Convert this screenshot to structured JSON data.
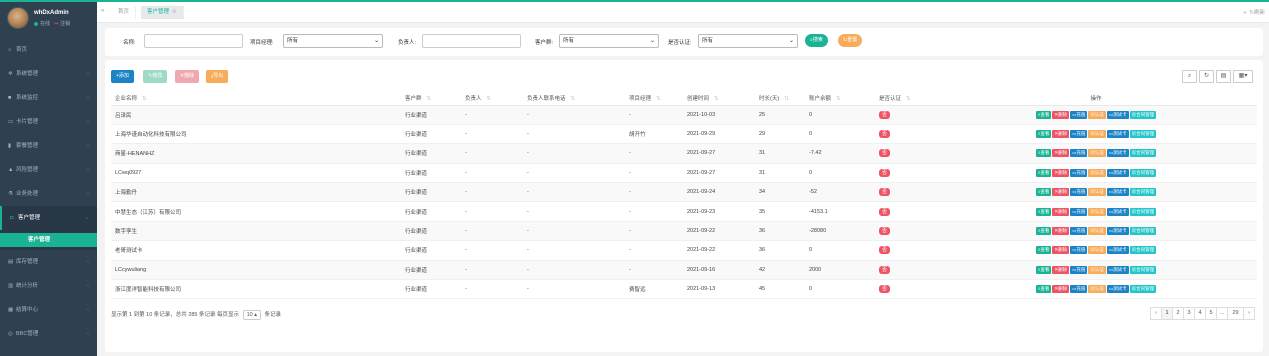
{
  "sidebar": {
    "username": "whDxAdmin",
    "status_online": "在线",
    "status_logout": "注销",
    "items": [
      {
        "label": "首页",
        "icon": "home-icon"
      },
      {
        "label": "系统管理",
        "icon": "gear-icon"
      },
      {
        "label": "系统监控",
        "icon": "video-icon"
      },
      {
        "label": "卡片管理",
        "icon": "card-icon"
      },
      {
        "label": "套餐管理",
        "icon": "chart-bar-icon"
      },
      {
        "label": "风险管理",
        "icon": "warning-icon"
      },
      {
        "label": "业务处理",
        "icon": "flask-icon"
      },
      {
        "label": "客户管理",
        "icon": "user-icon"
      },
      {
        "label": "库存管理",
        "icon": "database-icon"
      },
      {
        "label": "统计分析",
        "icon": "bar-chart-icon"
      },
      {
        "label": "结算中心",
        "icon": "settle-icon"
      },
      {
        "label": "BBC管理",
        "icon": "circle-icon"
      }
    ],
    "sub_active": "客户管理"
  },
  "tabs": {
    "home": "首页",
    "current": "客户管理",
    "refresh": "刷新"
  },
  "filter": {
    "name_label": "名称:",
    "name_value": "",
    "pm_label": "项目经理:",
    "pm_value": "所有",
    "owner_label": "负责人:",
    "owner_value": "",
    "group_label": "客户群:",
    "group_value": "所有",
    "cert_label": "是否认证:",
    "cert_value": "所有",
    "search_btn": "搜索",
    "reset_btn": "重置"
  },
  "toolbar": {
    "add": "添加",
    "edit": "修改",
    "delete": "删除",
    "export": "导出"
  },
  "table": {
    "headers": [
      "企业名称",
      "客户群",
      "负责人",
      "负责人联系电话",
      "项目经理",
      "创建时间",
      "时长(天)",
      "账户余额",
      "是否认证",
      "操作"
    ],
    "rows": [
      [
        "吕泽民",
        "行业渠道",
        "-",
        "-",
        "-",
        "2021-10-03",
        "25",
        "0",
        "否"
      ],
      [
        "上海华谨自动化科技有限公司",
        "行业渠道",
        "-",
        "-",
        "胡开竹",
        "2021-09-29",
        "29",
        "0",
        "否"
      ],
      [
        "商星-HENANHZ",
        "行业渠道",
        "-",
        "-",
        "-",
        "2021-09-27",
        "31",
        "-7.42",
        "否"
      ],
      [
        "LCwq0927",
        "行业渠道",
        "-",
        "-",
        "-",
        "2021-09-27",
        "31",
        "0",
        "否"
      ],
      [
        "上海勤丹",
        "行业渠道",
        "-",
        "-",
        "-",
        "2021-09-24",
        "34",
        "-52",
        "否"
      ],
      [
        "中慧生态（江苏）有限公司",
        "行业渠道",
        "-",
        "-",
        "-",
        "2021-09-23",
        "35",
        "-4153.1",
        "否"
      ],
      [
        "数字孪生",
        "行业渠道",
        "-",
        "-",
        "-",
        "2021-09-22",
        "36",
        "-28080",
        "否"
      ],
      [
        "老哥测试卡",
        "行业渠道",
        "-",
        "-",
        "-",
        "2021-09-22",
        "36",
        "0",
        "否"
      ],
      [
        "LCcywuliang",
        "行业渠道",
        "-",
        "-",
        "-",
        "2021-09-16",
        "42",
        "2000",
        "否"
      ],
      [
        "浙江度洋智能科技有限公司",
        "行业渠道",
        "-",
        "-",
        "费智远",
        "2021-09-13",
        "45",
        "0",
        "否"
      ]
    ],
    "ops": [
      "查看",
      "删除",
      "充值",
      "认证",
      "测试卡",
      "合同管理"
    ]
  },
  "pagination": {
    "summary_prefix": "显示第 1 到第 10 条记录，总共 285 条记录 每页显示",
    "page_size": "10",
    "summary_suffix": "条记录",
    "pages": [
      "‹",
      "1",
      "2",
      "3",
      "4",
      "5",
      "...",
      "29",
      "›"
    ]
  },
  "colors": {
    "sidebar": "#2f4050",
    "accent": "#1ab394",
    "danger": "#ed5565",
    "primary": "#1c84c6",
    "warning": "#f8ac59",
    "info": "#23c6c8"
  }
}
